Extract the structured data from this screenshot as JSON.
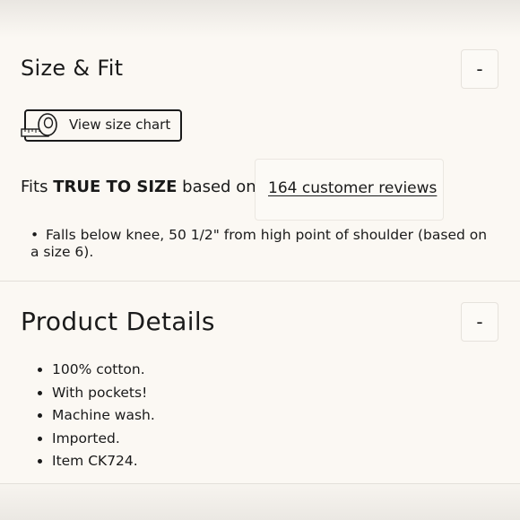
{
  "size_fit": {
    "title": "Size & Fit",
    "toggle_label": "-",
    "size_chart_label": "View size chart",
    "fits_prefix": "Fits",
    "fits_emphasis": "TRUE TO SIZE",
    "fits_suffix": "based on",
    "reviews_link": "164 customer reviews",
    "fit_note": "Falls below knee, 50 1/2\" from high point of shoulder (based on a size 6)."
  },
  "product_details": {
    "title": "Product Details",
    "toggle_label": "-",
    "items": [
      "100% cotton.",
      "With pockets!",
      "Machine wash.",
      "Imported.",
      "Item CK724."
    ]
  },
  "icons": {
    "size_chart": "measuring-tape-icon"
  }
}
